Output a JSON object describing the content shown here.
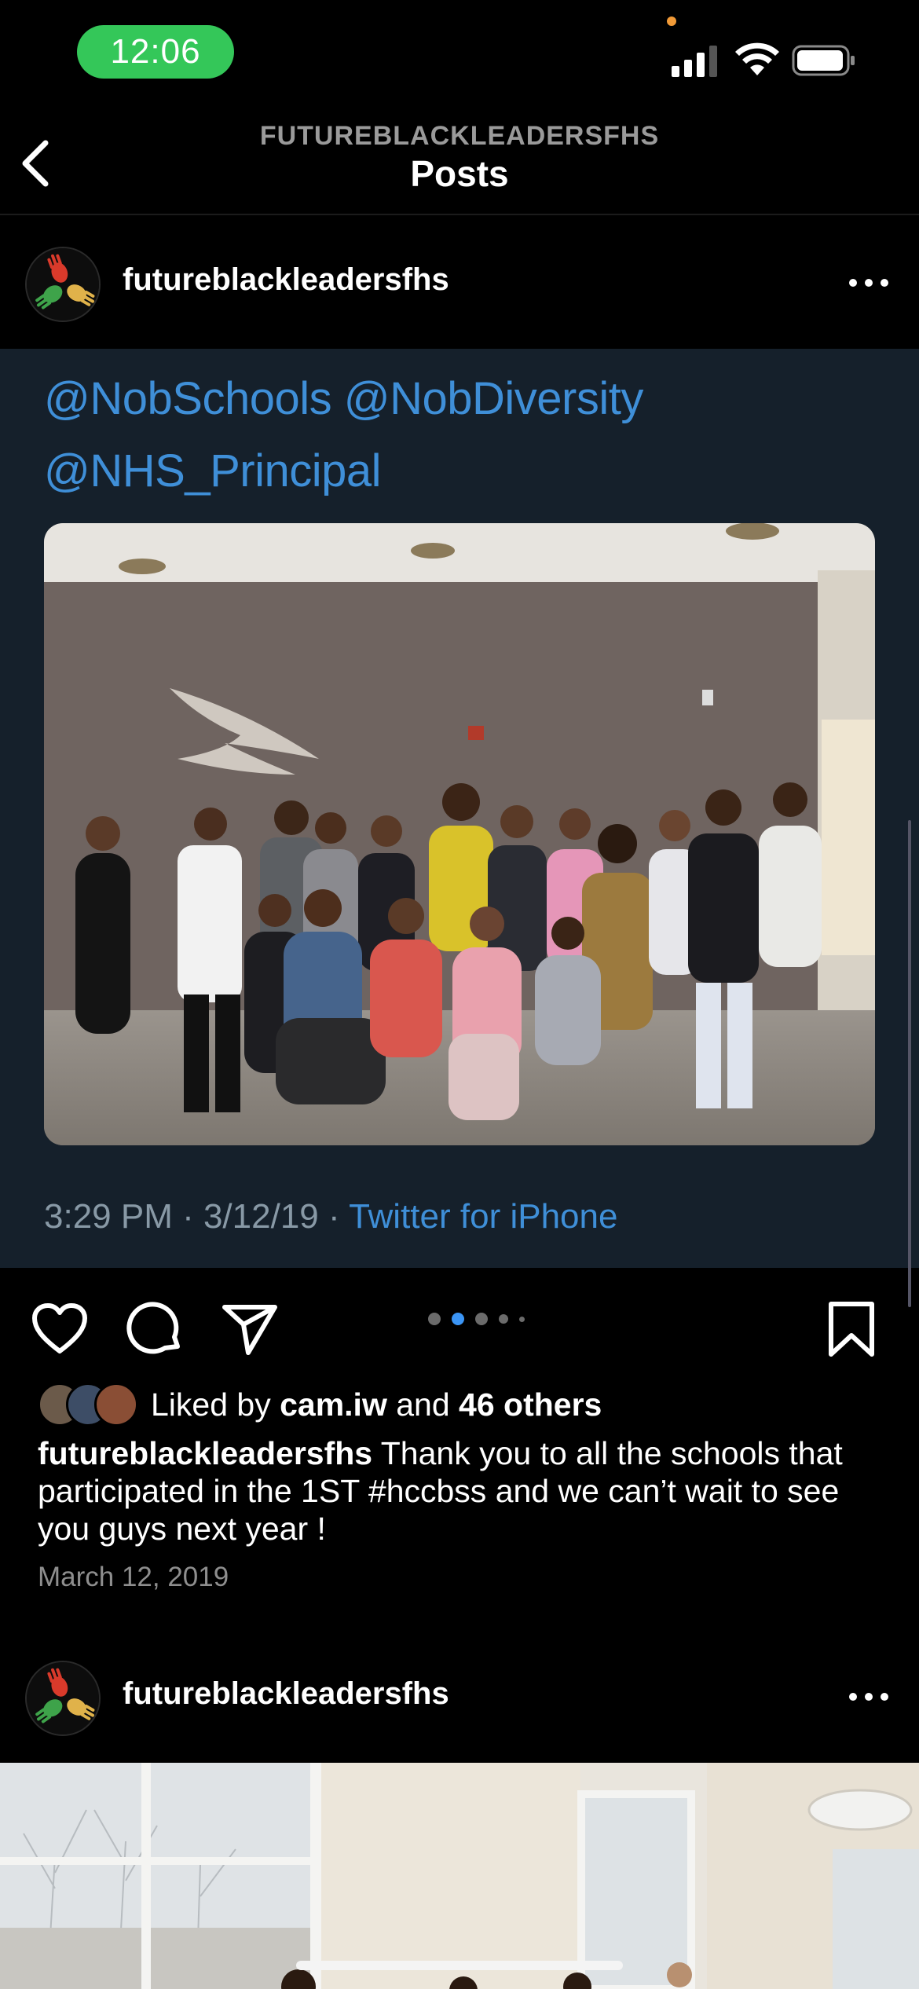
{
  "status_bar": {
    "time": "12:06",
    "time_pill_color": "#34c759",
    "icons": [
      "signal-icon",
      "wifi-icon",
      "battery-icon"
    ]
  },
  "nav": {
    "subtitle": "FUTUREBLACKLEADERSFHS",
    "title": "Posts",
    "back_icon": "chevron-left-icon"
  },
  "post": {
    "username": "futureblackleadersfhs",
    "tweet": {
      "mention_line_1": "@NobSchools @NobDiversity",
      "mention_line_2": "@NHS_Principal",
      "meta_time": "3:29 PM · 3/12/19 · ",
      "meta_client": "Twitter for iPhone",
      "background": "#15202b",
      "link_color": "#3f8fd8"
    },
    "actions": [
      "heart-icon",
      "comment-icon",
      "share-icon",
      "bookmark-icon"
    ],
    "carousel": {
      "count": 5,
      "active_index": 1
    },
    "likes": {
      "prefix": "Liked by ",
      "user": "cam.iw",
      "middle": " and ",
      "others": "46 others"
    },
    "caption": {
      "author": "futureblackleadersfhs",
      "text": " Thank you to all the schools that participated in the 1ST #hccbss and we can’t wait to see you guys next year !"
    },
    "date": "March 12, 2019"
  },
  "next_post": {
    "username": "futureblackleadersfhs"
  }
}
